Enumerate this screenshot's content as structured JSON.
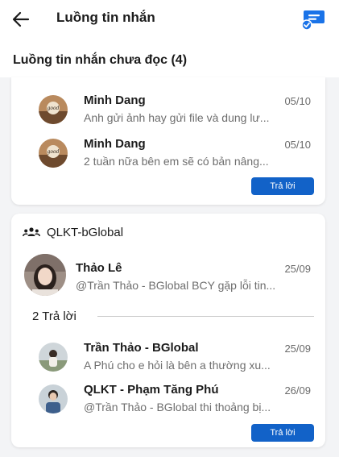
{
  "header": {
    "title": "Luồng tin nhắn"
  },
  "unread_section": {
    "title": "Luồng tin nhắn chưa đọc (4)"
  },
  "card1": {
    "messages": [
      {
        "name": "Minh Dang",
        "date": "05/10",
        "preview": "Anh gửi ảnh hay gửi file và dung lư..."
      },
      {
        "name": "Minh Dang",
        "date": "05/10",
        "preview": "2 tuần nữa bên em sẽ có bản nâng..."
      }
    ],
    "reply_label": "Trả lời"
  },
  "card2": {
    "group_name": "QLKT-bGlobal",
    "root": {
      "name": "Thảo Lê",
      "date": "25/09",
      "preview": "@Trần Thảo - BGlobal  BCY gặp lỗi tin..."
    },
    "replies_label": "2 Trả lời",
    "replies": [
      {
        "name": "Trần Thảo - BGlobal",
        "date": "25/09",
        "preview": "A Phú cho e hỏi là bên a thường xu..."
      },
      {
        "name": "QLKT - Phạm Tăng Phú",
        "date": "26/09",
        "preview": "@Trần Thảo - BGlobal thi thoảng bị..."
      }
    ],
    "reply_label": "Trả lời"
  },
  "colors": {
    "accent": "#1262c8",
    "background": "#f3f4f6"
  },
  "icons": {
    "back": "arrow-left-icon",
    "compose": "chat-check-icon",
    "group": "group-people-icon"
  }
}
